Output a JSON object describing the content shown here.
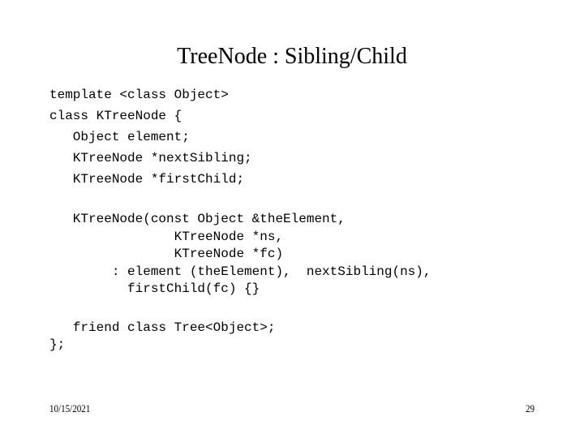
{
  "slide": {
    "title": "TreeNode : Sibling/Child",
    "code_lines": [
      "template <class Object>",
      "class KTreeNode {",
      "   Object element;",
      "   KTreeNode *nextSibling;",
      "   KTreeNode *firstChild;",
      "",
      "   KTreeNode(const Object &theElement,",
      "                KTreeNode *ns,",
      "                KTreeNode *fc)",
      "        : element (theElement),  nextSibling(ns),",
      "          firstChild(fc) {}",
      "",
      "   friend class Tree<Object>;",
      "};"
    ]
  },
  "footer": {
    "date": "10/15/2021",
    "page_number": "29"
  }
}
